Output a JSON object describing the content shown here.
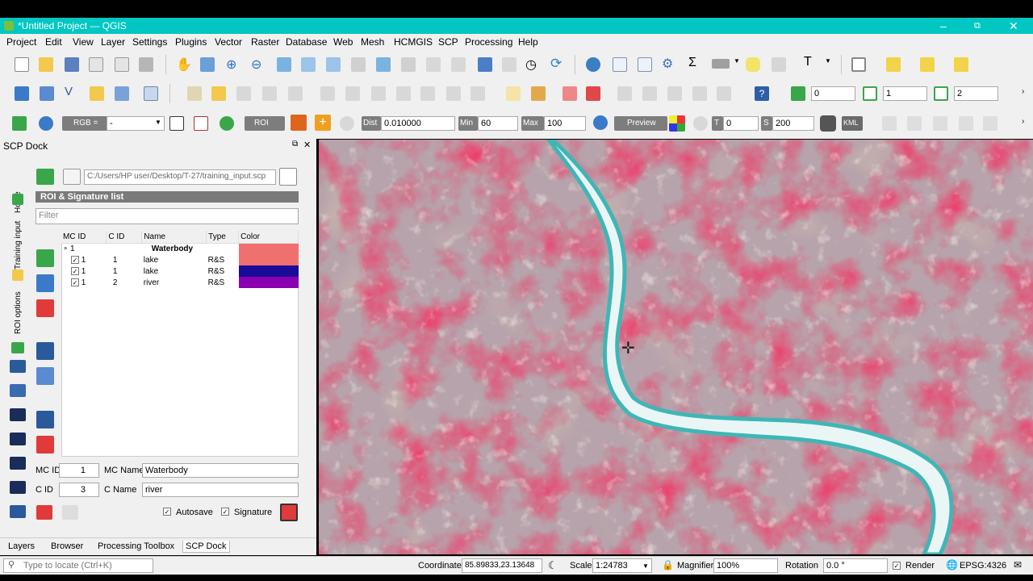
{
  "window": {
    "title": "*Untitled Project — QGIS"
  },
  "menu": [
    "Project",
    "Edit",
    "View",
    "Layer",
    "Settings",
    "Plugins",
    "Vector",
    "Raster",
    "Database",
    "Web",
    "Mesh",
    "HCMGIS",
    "SCP",
    "Processing",
    "Help"
  ],
  "toolbar1": {
    "spin_a": "0",
    "spin_b": "1",
    "spin_c": "2"
  },
  "toolbar2": {
    "rgb_label": "RGB =",
    "rgb_value": "-",
    "roi_label": "ROI",
    "dist_label": "Dist",
    "dist_value": "0.010000",
    "min_label": "Min",
    "min_value": "60",
    "max_label": "Max",
    "max_value": "100",
    "preview_label": "Preview",
    "t_label": "T",
    "t_value": "0",
    "s_label": "S",
    "s_value": "200",
    "kml_label": "KML"
  },
  "dock": {
    "title": "SCP Dock",
    "vertical_tabs": [
      "Home",
      "Training input",
      "ROI options"
    ],
    "file_path": "C:/Users/HP user/Desktop/T-27/training_input.scp",
    "section_title": "ROI & Signature list",
    "filter_placeholder": "Filter",
    "columns": [
      "MC ID",
      "C ID",
      "Name",
      "Type",
      "Color"
    ],
    "group": {
      "id": "1",
      "name": "Waterbody"
    },
    "rows": [
      {
        "mc_id": "1",
        "c_id": "1",
        "name": "lake",
        "type": "R&S",
        "color": "#f07070"
      },
      {
        "mc_id": "1",
        "c_id": "1",
        "name": "lake",
        "type": "R&S",
        "color": "#1a0a9a"
      },
      {
        "mc_id": "1",
        "c_id": "2",
        "name": "river",
        "type": "R&S",
        "color": "#8a00b0"
      }
    ],
    "mc_id_label": "MC ID",
    "mc_id_value": "1",
    "mc_name_label": "MC Name",
    "mc_name_value": "Waterbody",
    "c_id_label": "C ID",
    "c_id_value": "3",
    "c_name_label": "C Name",
    "c_name_value": "river",
    "autosave_label": "Autosave",
    "signature_label": "Signature"
  },
  "bottom_tabs": [
    "Layers",
    "Browser",
    "Processing Toolbox",
    "SCP Dock"
  ],
  "status": {
    "locate_placeholder": "Type to locate (Ctrl+K)",
    "coordinate_label": "Coordinate",
    "coordinate_value": "85.89833,23.13648",
    "scale_label": "Scale",
    "scale_value": "1:24783",
    "magnifier_label": "Magnifier",
    "magnifier_value": "100%",
    "rotation_label": "Rotation",
    "rotation_value": "0.0 °",
    "render_label": "Render",
    "crs_label": "EPSG:4326"
  },
  "colors": {
    "title_bar": "#00c7c2",
    "accent_green": "#3aa64a"
  }
}
